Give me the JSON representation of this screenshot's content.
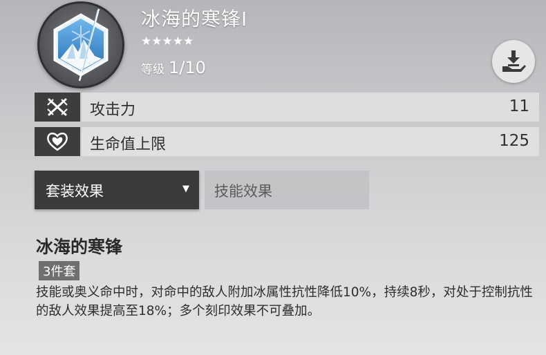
{
  "item": {
    "name": "冰海的寒锋I",
    "stars": "★★★★★",
    "level_label": "等级",
    "level_value": "1/10",
    "emblem_icon": "ice-crystal-emblem-icon"
  },
  "actions": {
    "download_icon": "download-hand-icon"
  },
  "stats": [
    {
      "icon": "crossed-swords-icon",
      "name": "攻击力",
      "value": "11"
    },
    {
      "icon": "heart-shield-icon",
      "name": "生命值上限",
      "value": "125"
    }
  ],
  "tabs": {
    "active": {
      "label": "套装效果",
      "caret": "▼"
    },
    "inactive": {
      "label": "技能效果"
    }
  },
  "set_effect": {
    "name": "冰海的寒锋",
    "badge": "3件套",
    "description": "技能或奥义命中时，对命中的敌人附加冰属性抗性降低10%，持续8秒，对处于控制抗性的敌人效果提高至18%；多个刻印效果不可叠加。"
  },
  "colors": {
    "dark_panel": "#3a3a3c",
    "emblem_blue": "#3f8fd0"
  }
}
